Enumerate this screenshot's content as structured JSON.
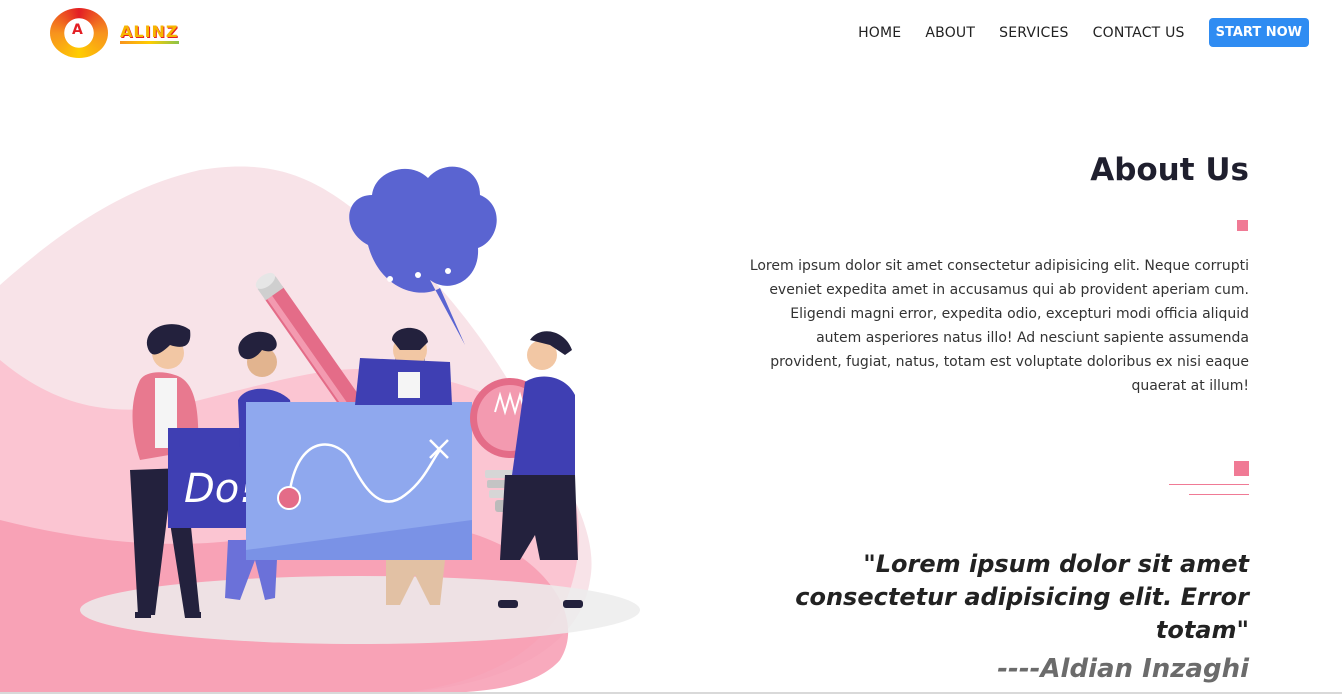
{
  "brand": {
    "name": "ALINZ",
    "logo_letter": "A"
  },
  "nav": {
    "items": [
      "HOME",
      "ABOUT",
      "SERVICES",
      "CONTACT US"
    ],
    "cta_label": "START NOW"
  },
  "about": {
    "title": "About Us",
    "paragraph": "Lorem ipsum dolor sit amet consectetur adipisicing elit. Neque corrupti eveniet expedita amet in accusamus qui ab provident aperiam cum. Eligendi magni error, expedita odio, excepturi modi officia aliquid autem asperiores natus illo! Ad nesciunt sapiente assumenda provident, fugiat, natus, totam est voluptate doloribus ex nisi eaque quaerat at illum!",
    "quote": "\"Lorem ipsum dolor sit amet consectetur adipisicing elit. Error totam\"",
    "author": "----Aldian Inzaghi"
  },
  "illustration": {
    "board_text": "Do!"
  },
  "colors": {
    "accent": "#f07a95",
    "cta": "#2f8cf2",
    "bubble": "#5a64d1"
  }
}
